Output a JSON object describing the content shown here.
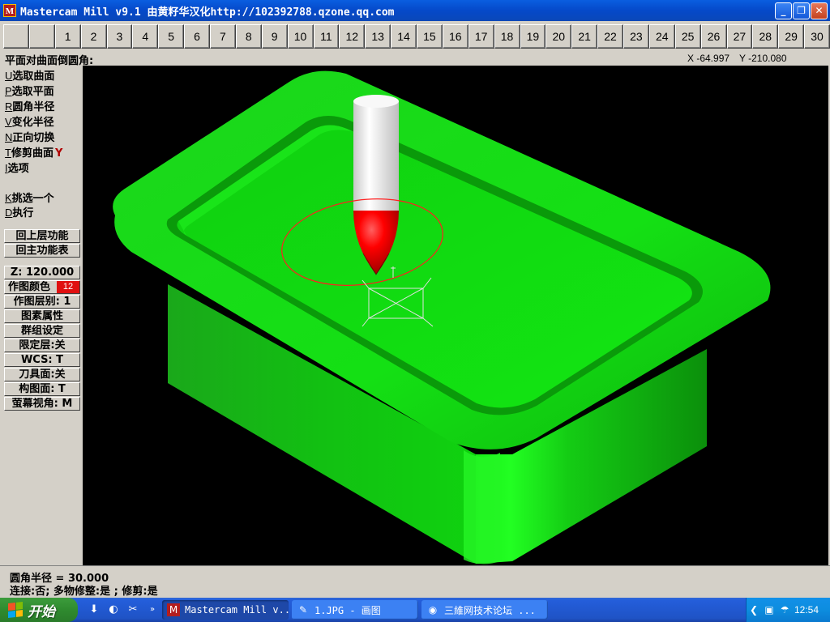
{
  "window": {
    "title": "Mastercam Mill v9.1 由黄籽华汉化http://102392788.qzone.qq.com",
    "icon_glyph": "M",
    "controls": {
      "minimize": "_",
      "maximize": "❐",
      "close": "✕"
    }
  },
  "levels": [
    "",
    "",
    "1",
    "2",
    "3",
    "4",
    "5",
    "6",
    "7",
    "8",
    "9",
    "10",
    "11",
    "12",
    "13",
    "14",
    "15",
    "16",
    "17",
    "18",
    "19",
    "20",
    "21",
    "22",
    "23",
    "24",
    "25",
    "26",
    "27",
    "28",
    "29",
    "30"
  ],
  "prompt": {
    "text": "平面对曲面倒圆角:",
    "x_readout": "X -64.997",
    "y_readout": "Y -210.080"
  },
  "menu": {
    "items": [
      {
        "hotkey": "U",
        "label": "选取曲面",
        "flag": ""
      },
      {
        "hotkey": "P",
        "label": "选取平面",
        "flag": ""
      },
      {
        "hotkey": "R",
        "label": "圆角半径",
        "flag": ""
      },
      {
        "hotkey": "V",
        "label": "变化半径",
        "flag": ""
      },
      {
        "hotkey": "N",
        "label": "正向切换",
        "flag": ""
      },
      {
        "hotkey": "T",
        "label": "修剪曲面",
        "flag": "Y"
      },
      {
        "hotkey": "I",
        "label": "选项",
        "flag": ""
      }
    ],
    "actions": [
      {
        "hotkey": "K",
        "label": "挑选一个"
      },
      {
        "hotkey": "D",
        "label": "执行"
      }
    ],
    "nav": [
      "回上层功能",
      "回主功能表"
    ],
    "settings": {
      "z_depth": "Z: 120.000",
      "draw_color": "作图颜色",
      "draw_color_value": "12",
      "draw_level": "作图层别: 1",
      "entity_attr": "图素属性",
      "group_setup": "群组设定",
      "level_limit": "限定层:关",
      "wcs": "WCS:  T",
      "tool_plane": "刀具面:关",
      "construction_plane": "构图面: T",
      "screen_view": "萤幕视角: M"
    }
  },
  "status": {
    "line1": "圆角半径 = 30.000",
    "line2": "连接:否; 多物修整:是 ; 修剪:是"
  },
  "taskbar": {
    "start_label": "开始",
    "tasks": [
      {
        "label": "Mastercam Mill v...",
        "icon": "M",
        "active": true
      },
      {
        "label": "1.JPG - 画图",
        "icon": "✎",
        "active": false
      },
      {
        "label": "三維网技术论坛 ...",
        "icon": "◉",
        "active": false
      }
    ],
    "clock": "12:54"
  },
  "colors": {
    "part_green": "#00e000",
    "tool_white": "#f4f4f4",
    "tool_tip_red": "#ff0000",
    "highlight_red": "#e01010",
    "viewport_bg": "#000000"
  },
  "icons": {
    "app": "mastercam-icon",
    "tool": "ball-endmill-icon",
    "start_logo": "windows-logo-icon"
  }
}
